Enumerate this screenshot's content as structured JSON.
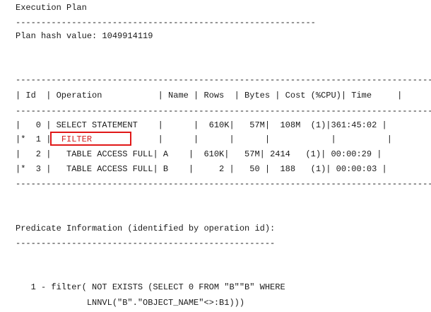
{
  "title": "Execution Plan",
  "separator_short": "-----------------------------------------------------------",
  "hash_line": "Plan hash value: 1049914119",
  "table": {
    "separator": "-----------------------------------------------------------------------------------",
    "header": "| Id  | Operation           | Name | Rows  | Bytes | Cost (%CPU)| Time     |",
    "rows": [
      {
        "prefix": "|   0 | ",
        "op": "SELECT STATEMENT",
        "rest": "    |      |  610K|   57M|  108M  (1)|361:45:02 |"
      },
      {
        "prefix": "|*  1 |  ",
        "op": "FILTER",
        "rest": "             |      |      |      |            |          |"
      },
      {
        "prefix": "|   2 |   ",
        "op": "TABLE ACCESS FULL",
        "rest": "| A    |  610K|   57M| 2414   (1)| 00:00:29 |"
      },
      {
        "prefix": "|*  3 |   ",
        "op": "TABLE ACCESS FULL",
        "rest": "| B    |     2 |   50 |  188   (1)| 00:00:03 |"
      }
    ]
  },
  "predicate": {
    "title": "Predicate Information (identified by operation id):",
    "separator": "---------------------------------------------------",
    "line1": "   1 - filter( NOT EXISTS (SELECT 0 FROM \"B\"\"B\" WHERE",
    "line2": "              LNNVL(\"B\".\"OBJECT_NAME\"<>:B1)))"
  },
  "colors": {
    "highlight": "#e01818",
    "filter_text": "#d22020"
  }
}
